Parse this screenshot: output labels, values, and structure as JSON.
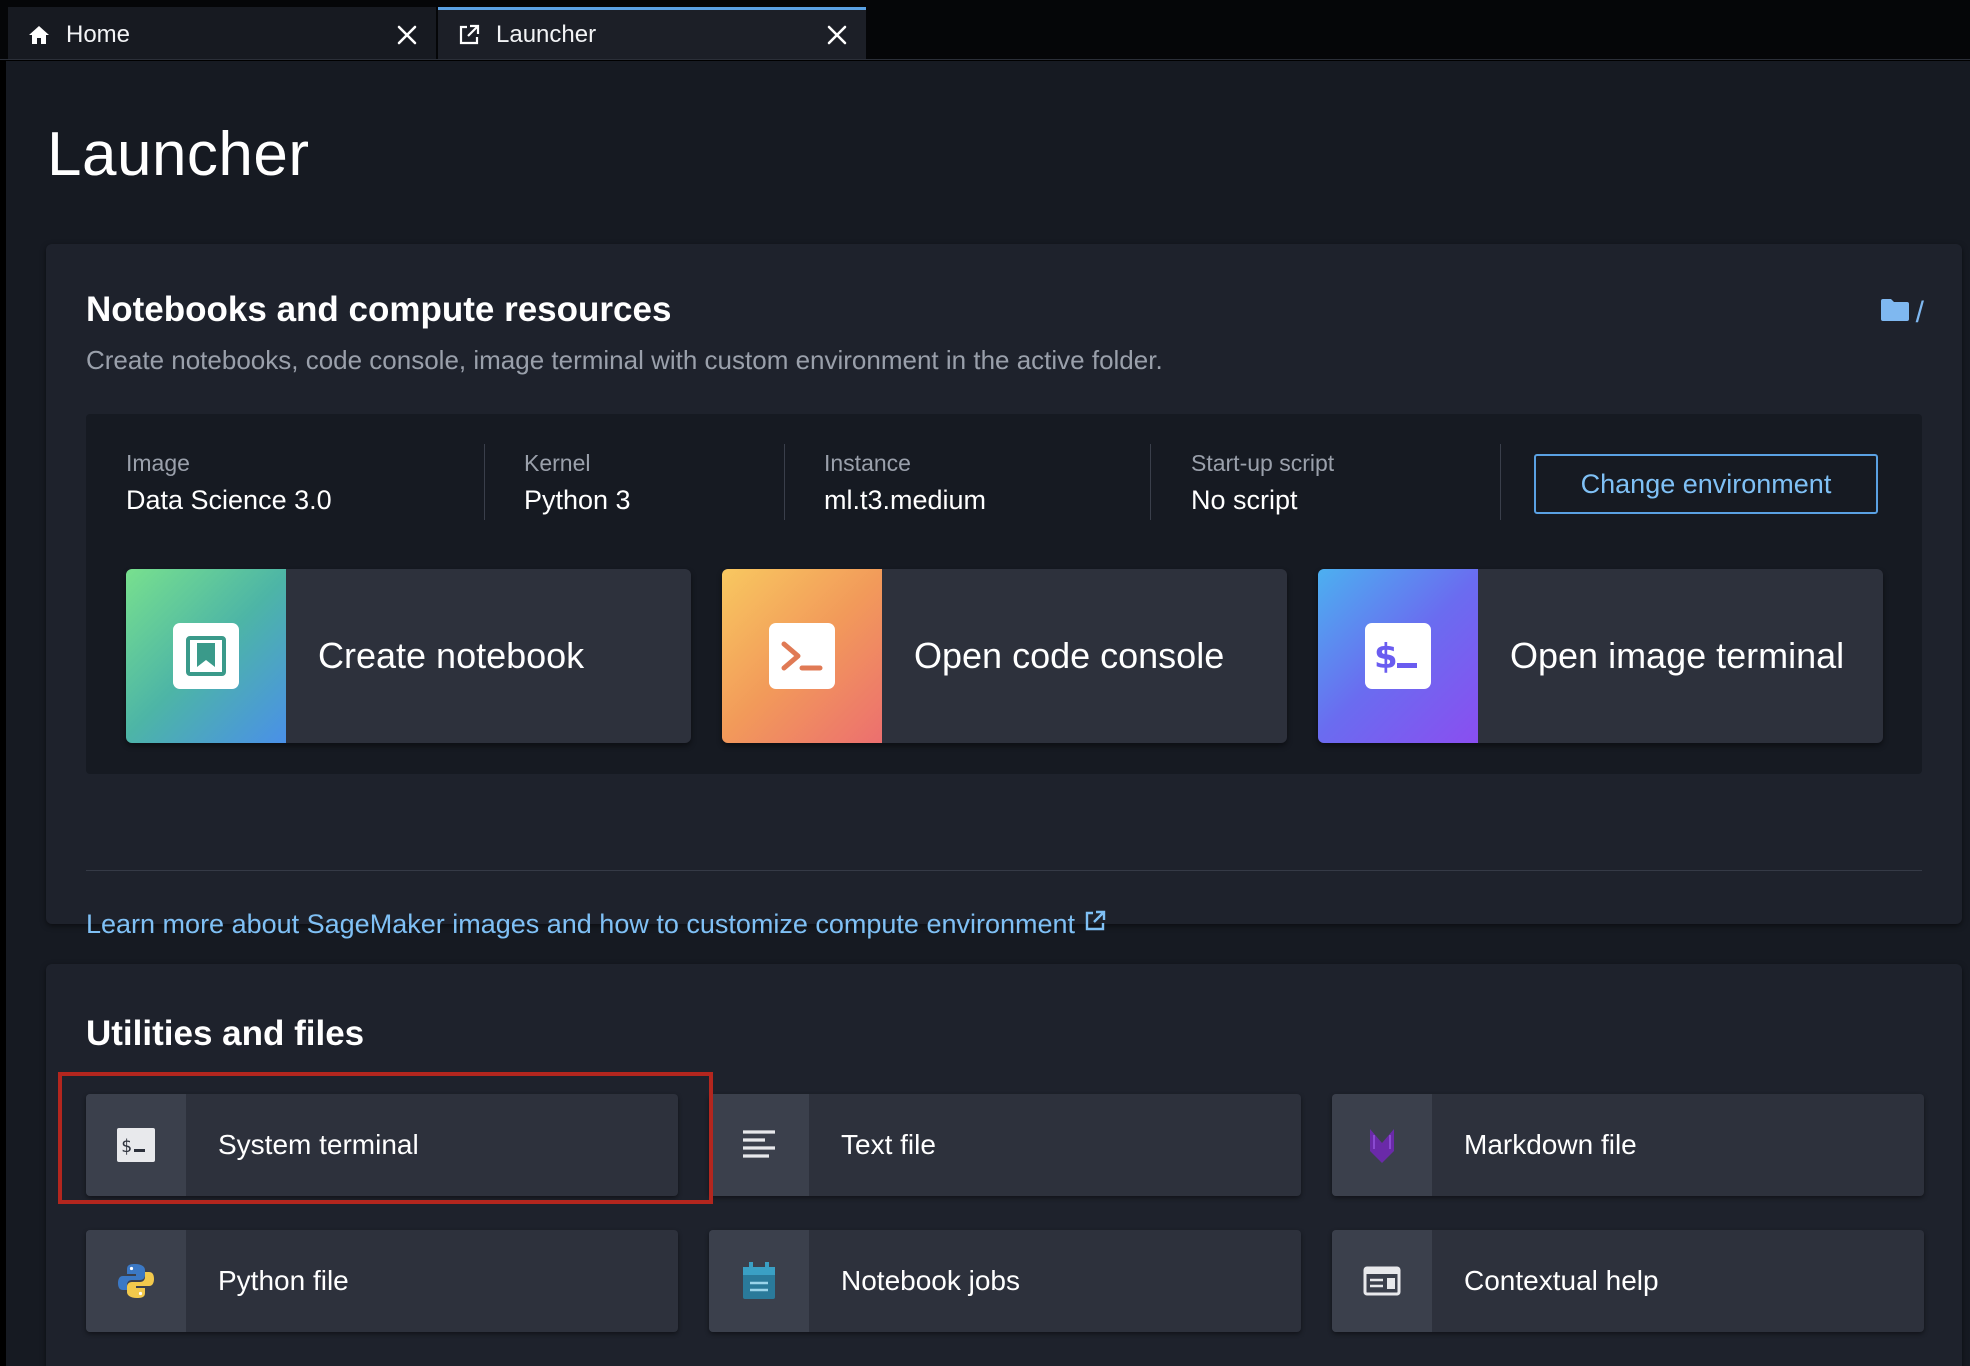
{
  "tabs": [
    {
      "label": "Home",
      "icon": "home-icon",
      "active": false
    },
    {
      "label": "Launcher",
      "icon": "launcher-icon",
      "active": true
    }
  ],
  "page": {
    "title": "Launcher"
  },
  "notebooks_section": {
    "title": "Notebooks and compute resources",
    "subtitle": "Create notebooks, code console, image terminal with custom environment in the active folder.",
    "folder_path": "/",
    "environment": {
      "image_label": "Image",
      "image_value": "Data Science 3.0",
      "kernel_label": "Kernel",
      "kernel_value": "Python 3",
      "instance_label": "Instance",
      "instance_value": "ml.t3.medium",
      "startup_label": "Start-up script",
      "startup_value": "No script",
      "change_button": "Change environment"
    },
    "launch_cards": [
      {
        "label": "Create notebook",
        "icon": "notebook-icon"
      },
      {
        "label": "Open code console",
        "icon": "code-console-icon"
      },
      {
        "label": "Open image terminal",
        "icon": "image-terminal-icon"
      }
    ],
    "learn_more": "Learn more about SageMaker images and how to customize compute environment"
  },
  "utilities_section": {
    "title": "Utilities and files",
    "items": [
      {
        "label": "System terminal",
        "icon": "system-terminal-icon"
      },
      {
        "label": "Text file",
        "icon": "text-file-icon"
      },
      {
        "label": "Markdown file",
        "icon": "markdown-icon"
      },
      {
        "label": "Python file",
        "icon": "python-icon"
      },
      {
        "label": "Notebook jobs",
        "icon": "calendar-icon"
      },
      {
        "label": "Contextual help",
        "icon": "contextual-help-icon"
      }
    ]
  },
  "colors": {
    "background": "#161a22",
    "panel": "#1e222c",
    "card": "#2d313c",
    "accent": "#5aa1e3",
    "highlight": "#b3261e"
  }
}
